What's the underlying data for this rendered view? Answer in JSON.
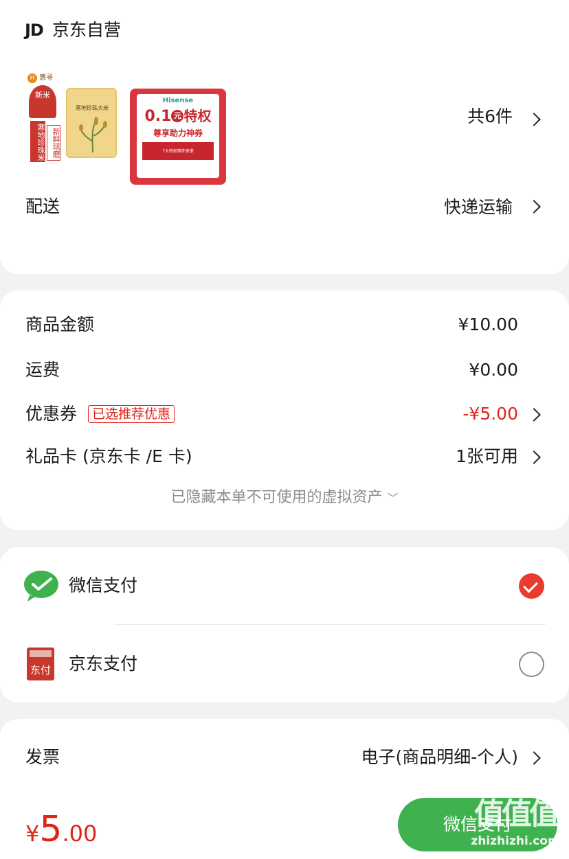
{
  "shop": {
    "logo": "JD",
    "name": "京东自营",
    "item_count": "共6件",
    "delivery_label": "配送",
    "delivery_value": "快递运输"
  },
  "products": [
    {
      "brand": "惠寻",
      "badge": "新米",
      "tag_left": "寒地珍珠米",
      "tag_right": "新鲜现磨",
      "package_text": "寒地珍珠大米"
    },
    {
      "brand": "Hisense",
      "price_text": "0.1",
      "unit": "元",
      "title": "特权",
      "subtitle": "尊享助力神券",
      "note": "7大特权等你来拿"
    }
  ],
  "amounts": {
    "goods_label": "商品金额",
    "goods_value": "¥10.00",
    "shipping_label": "运费",
    "shipping_value": "¥0.00",
    "coupon_label": "优惠券",
    "coupon_tag": "已选推荐优惠",
    "coupon_value": "-¥5.00",
    "giftcard_label": "礼品卡 (京东卡 /E 卡)",
    "giftcard_value": "1张可用",
    "hidden_note": "已隐藏本单不可使用的虚拟资产"
  },
  "payment": {
    "wechat_label": "微信支付",
    "jdpay_label": "京东支付",
    "jdpay_icon_text": "东付",
    "selected": "wechat"
  },
  "invoice": {
    "label": "发票",
    "value": "电子(商品明细-个人)"
  },
  "footer": {
    "currency": "¥",
    "total_int": "5",
    "total_dec": ".00",
    "pay_button": "微信支付",
    "watermark_top": "值值值",
    "watermark_bottom": "zhizhizhi.com"
  },
  "colors": {
    "accent_red": "#e2231a",
    "wechat_green": "#3fb24f"
  }
}
